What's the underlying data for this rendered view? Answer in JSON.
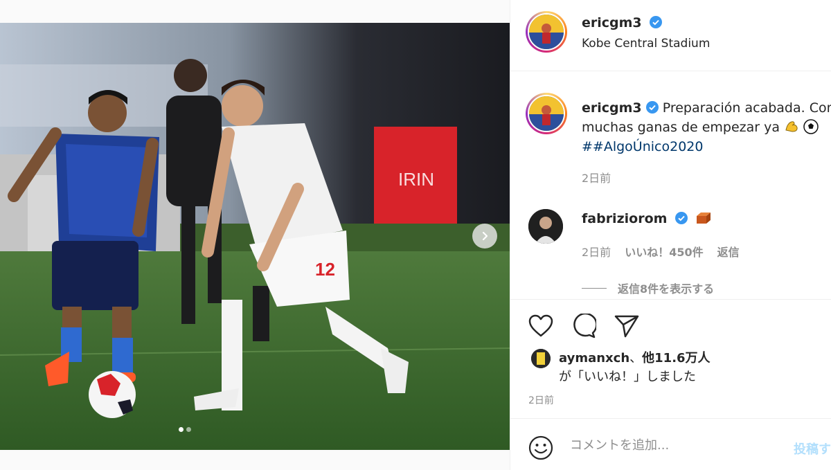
{
  "header": {
    "username": "ericgm3",
    "location": "Kobe Central Stadium"
  },
  "caption": {
    "username": "ericgm3",
    "text_1": "Preparación acabada. Con",
    "text_2": "muchas ganas de empezar ya",
    "emojis": [
      "flexed-biceps",
      "soccer-ball"
    ],
    "hashtag": "##AlgoÚnico2020",
    "time": "2日前"
  },
  "comment": {
    "username": "fabriziorom",
    "emoji": "brick",
    "time": "2日前",
    "likes": "いいね！450件",
    "reply": "返信",
    "view_replies": "返信8件を表示する"
  },
  "likes": {
    "user": "aymanxch",
    "sep": "、",
    "others": "他11.6万人",
    "suffix": "が「いいね！」しました"
  },
  "post_time": "2日前",
  "add_comment": {
    "placeholder": "コメントを追加...",
    "post_label": "投稿す"
  },
  "carousel": {
    "dots": 2,
    "active_index": 0
  },
  "colors": {
    "link": "#00376b",
    "verified": "#3897f0",
    "muted": "#8e8e8e",
    "post_disabled": "#b2dffc"
  }
}
